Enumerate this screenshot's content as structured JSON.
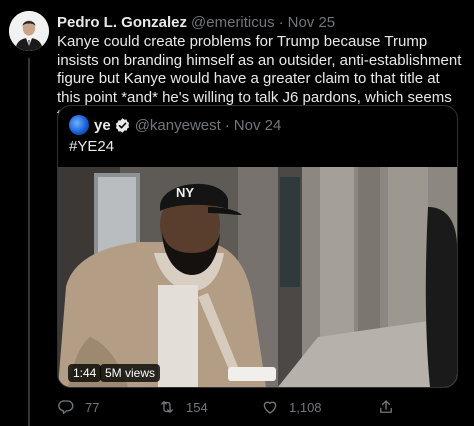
{
  "tweet": {
    "author_name": "Pedro L. Gonzalez",
    "author_handle": "@emeriticus",
    "separator": "·",
    "date": "Nov 25",
    "text": "Kanye could create problems for Trump because Trump insists on branding himself as an outsider, anti-establishment figure but Kanye would have a greater claim to that title at this point *and* he's willing to talk J6 pardons, which seems to make Trump uncomfortable"
  },
  "quoted_tweet": {
    "author_name": "ye",
    "author_handle": "@kanyewest",
    "separator": "·",
    "date": "Nov 24",
    "text": "#YE24",
    "video": {
      "duration": "1:44",
      "views": "5M views",
      "cap_text": "NY"
    }
  },
  "actions": {
    "replies": "77",
    "retweets": "154",
    "likes": "1,108"
  },
  "colors": {
    "background": "#000000",
    "text_primary": "#e7e9ea",
    "text_secondary": "#71767b",
    "border": "#2f3336",
    "verified": "#1d9bf0"
  },
  "icons": [
    "avatar",
    "verified-badge-icon",
    "reply-icon",
    "retweet-icon",
    "like-icon",
    "share-icon"
  ]
}
